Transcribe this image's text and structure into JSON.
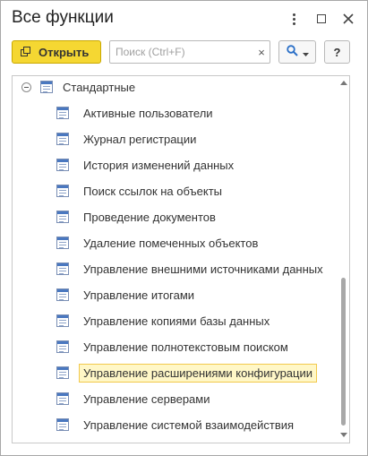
{
  "window": {
    "title": "Все функции"
  },
  "toolbar": {
    "open_label": "Открыть",
    "search_placeholder": "Поиск (Ctrl+F)",
    "search_value": "",
    "clear_glyph": "×",
    "help_label": "?"
  },
  "tree": {
    "root": {
      "label": "Стандартные",
      "expanded": true
    },
    "items": [
      {
        "label": "Активные пользователи"
      },
      {
        "label": "Журнал регистрации"
      },
      {
        "label": "История изменений данных"
      },
      {
        "label": "Поиск ссылок на объекты"
      },
      {
        "label": "Проведение документов"
      },
      {
        "label": "Удаление помеченных объектов"
      },
      {
        "label": "Управление внешними источниками данных"
      },
      {
        "label": "Управление итогами"
      },
      {
        "label": "Управление копиями базы данных"
      },
      {
        "label": "Управление полнотекстовым поиском"
      },
      {
        "label": "Управление расширениями конфигурации"
      },
      {
        "label": "Управление серверами"
      },
      {
        "label": "Управление системой взаимодействия"
      }
    ],
    "selected_index": 10
  },
  "icons": {
    "more": "more-vertical-icon",
    "maximize": "maximize-icon",
    "close": "close-icon",
    "open": "open-form-icon",
    "search": "search-icon",
    "dropdown": "chevron-down-icon",
    "collapse": "collapse-icon",
    "item": "report-form-icon"
  },
  "colors": {
    "accent_button": "#f5d732",
    "selection_fill": "#fff7c7",
    "selection_border": "#f2c94c",
    "search_icon": "#2a6fc7"
  }
}
